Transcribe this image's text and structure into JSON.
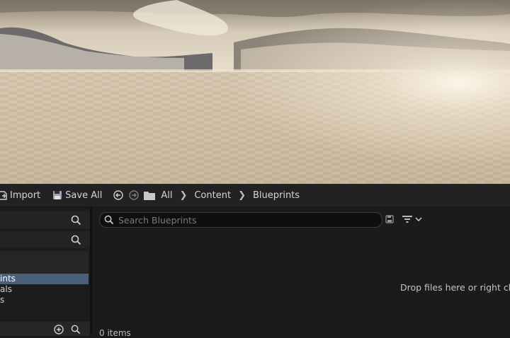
{
  "toolbar": {
    "import_label": "Import",
    "save_all_label": "Save All",
    "breadcrumb": [
      "All",
      "Content",
      "Blueprints"
    ]
  },
  "tree": {
    "items": [
      "ints",
      "als",
      "s"
    ]
  },
  "main": {
    "search_placeholder": "Search Blueprints",
    "drop_hint": "Drop files here or right click",
    "item_count": "0 items"
  },
  "colors": {
    "selected_row": "#4a5f78",
    "panel_bg": "#1b1b1b",
    "toolbar_bg": "#222222"
  }
}
